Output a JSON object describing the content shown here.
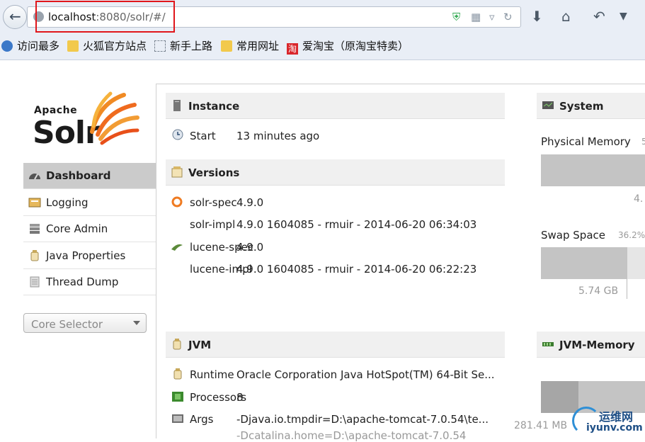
{
  "browser": {
    "url_host": "localhost",
    "url_rest": ":8080/solr/#/",
    "bookmarks": [
      "访问最多",
      "火狐官方站点",
      "新手上路",
      "常用网址",
      "爱淘宝（原淘宝特卖）"
    ],
    "taobao_glyph": "淘"
  },
  "logo": {
    "apache": "Apache",
    "solr": "Solr"
  },
  "nav": {
    "items": [
      {
        "label": "Dashboard",
        "icon": "dashboard-icon",
        "active": true
      },
      {
        "label": "Logging",
        "icon": "logging-icon"
      },
      {
        "label": "Core Admin",
        "icon": "core-admin-icon"
      },
      {
        "label": "Java Properties",
        "icon": "java-properties-icon"
      },
      {
        "label": "Thread Dump",
        "icon": "thread-dump-icon"
      }
    ],
    "core_selector": "Core Selector"
  },
  "instance": {
    "title": "Instance",
    "start_label": "Start",
    "start_value": "13 minutes ago"
  },
  "versions": {
    "title": "Versions",
    "rows": [
      {
        "key": "solr-spec",
        "value": "4.9.0"
      },
      {
        "key": "solr-impl",
        "value": "4.9.0 1604085 - rmuir - 2014-06-20 06:34:03"
      },
      {
        "key": "lucene-spec",
        "value": "4.9.0"
      },
      {
        "key": "lucene-impl",
        "value": "4.9.0 1604085 - rmuir - 2014-06-20 06:22:23"
      }
    ]
  },
  "jvm": {
    "title": "JVM",
    "runtime_label": "Runtime",
    "runtime_value": "Oracle Corporation Java HotSpot(TM) 64-Bit Se...",
    "processors_label": "Processors",
    "processors_value": "8",
    "args_label": "Args",
    "args": [
      "-Djava.io.tmpdir=D:\\apache-tomcat-7.0.54\\te...",
      "-Dcatalina.home=D:\\apache-tomcat-7.0.54"
    ]
  },
  "system": {
    "title": "System",
    "physical_memory_label": "Physical Memory",
    "physical_percent_cut": "5",
    "physical_value_cut": "4.",
    "swap_label": "Swap Space",
    "swap_percent": "36.2%",
    "swap_value": "5.74 GB"
  },
  "jvm_memory": {
    "title": "JVM-Memory",
    "value": "281.41 MB"
  },
  "watermark": {
    "line1": "运维网",
    "line2": "iyunv.com"
  }
}
